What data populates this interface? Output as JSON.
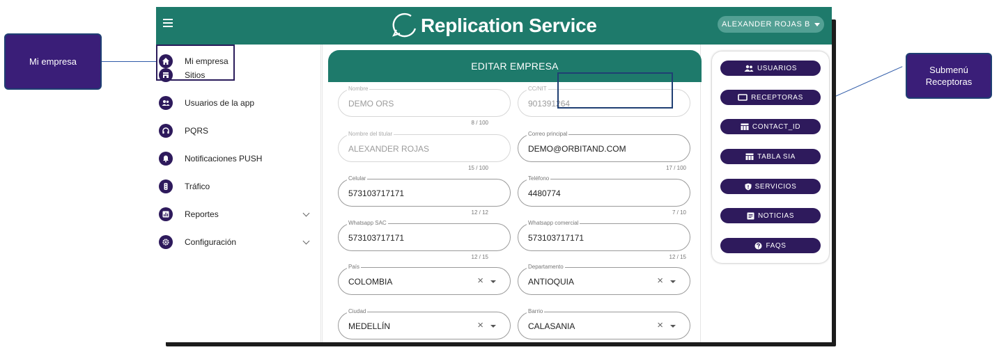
{
  "callouts": {
    "left": "Mi empresa",
    "right_line1": "Submenú",
    "right_line2": "Receptoras"
  },
  "header": {
    "title": "Replication Service",
    "user": "ALEXANDER ROJAS B"
  },
  "sidebar": {
    "items": [
      {
        "label": "Mi empresa",
        "icon": "home-icon"
      },
      {
        "label": "Sitios",
        "icon": "store-icon"
      },
      {
        "label": "Usuarios de la app",
        "icon": "group-icon"
      },
      {
        "label": "PQRS",
        "icon": "headset-icon"
      },
      {
        "label": "Notificaciones PUSH",
        "icon": "bell-icon"
      },
      {
        "label": "Tráfico",
        "icon": "traffic-light-icon"
      },
      {
        "label": "Reportes",
        "icon": "chart-icon"
      },
      {
        "label": "Configuración",
        "icon": "gear-icon"
      }
    ]
  },
  "form": {
    "title": "EDITAR EMPRESA",
    "nombre": {
      "label": "Nombre",
      "value": "DEMO ORS",
      "counter": "8 / 100"
    },
    "ccnit": {
      "label": "CC/NIT",
      "value": "901391264"
    },
    "titular": {
      "label": "Nombre del titular",
      "value": "ALEXANDER ROJAS",
      "counter": "15 / 100"
    },
    "correo": {
      "label": "Correo principal",
      "value": "DEMO@ORBITAND.COM",
      "counter": "17 / 100"
    },
    "celular": {
      "label": "Celular",
      "value": "573103717171",
      "counter": "12 / 12"
    },
    "telefono": {
      "label": "Teléfono",
      "value": "4480774",
      "counter": "7 / 10"
    },
    "whatsapp_sac": {
      "label": "Whatsapp SAC",
      "value": "573103717171",
      "counter": "12 / 15"
    },
    "whatsapp_comercial": {
      "label": "Whatsapp comercial",
      "value": "573103717171",
      "counter": "12 / 15"
    },
    "pais": {
      "label": "País",
      "value": "COLOMBIA"
    },
    "departamento": {
      "label": "Departamento",
      "value": "ANTIOQUIA"
    },
    "ciudad": {
      "label": "Ciudad",
      "value": "MEDELLÍN"
    },
    "barrio": {
      "label": "Barrio",
      "value": "CALASANIA"
    }
  },
  "submenu": {
    "items": [
      {
        "label": "USUARIOS",
        "icon": "group-icon"
      },
      {
        "label": "RECEPTORAS",
        "icon": "monitor-icon"
      },
      {
        "label": "CONTACT_ID",
        "icon": "table-icon"
      },
      {
        "label": "TABLA SIA",
        "icon": "table-icon"
      },
      {
        "label": "SERVICIOS",
        "icon": "shield-icon"
      },
      {
        "label": "NOTICIAS",
        "icon": "article-icon"
      },
      {
        "label": "FAQS",
        "icon": "help-icon"
      }
    ]
  },
  "colors": {
    "primary": "#1e7a6b",
    "accent": "#2e1a5c",
    "callout": "#3a1e78"
  }
}
